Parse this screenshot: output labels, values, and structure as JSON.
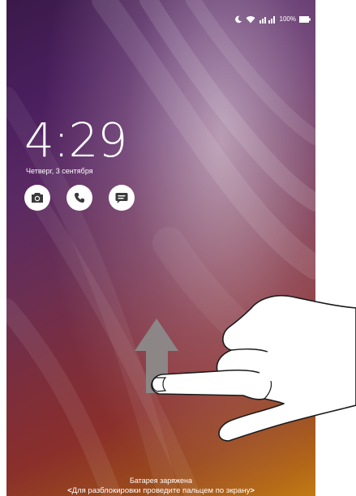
{
  "status_bar": {
    "battery_percent": "100%",
    "icons": [
      "moon-icon",
      "wifi-icon",
      "signal-icon",
      "battery-icon"
    ]
  },
  "lockscreen": {
    "time": "4:29",
    "date": "Четверг, 3 сентября",
    "shortcuts": [
      {
        "icon": "camera-icon",
        "color": "#3a3a3a"
      },
      {
        "icon": "phone-icon",
        "color": "#3a3a3a"
      },
      {
        "icon": "message-icon",
        "color": "#3a3a3a"
      }
    ],
    "battery_message": "Батарея заряжена",
    "unlock_hint": "Для разблокировки проведите пальцем по экрану",
    "chevron_left": "<",
    "chevron_right": ">"
  },
  "gesture": {
    "arrow_icon": "up-arrow-icon",
    "hand_icon": "pointing-hand-icon"
  },
  "colors": {
    "wallpaper_top": "#3a1a4a",
    "wallpaper_mid": "#7d2e3b",
    "wallpaper_bottom": "#c27a14",
    "text": "#ffffff",
    "arrow": "#8a8a8a"
  }
}
